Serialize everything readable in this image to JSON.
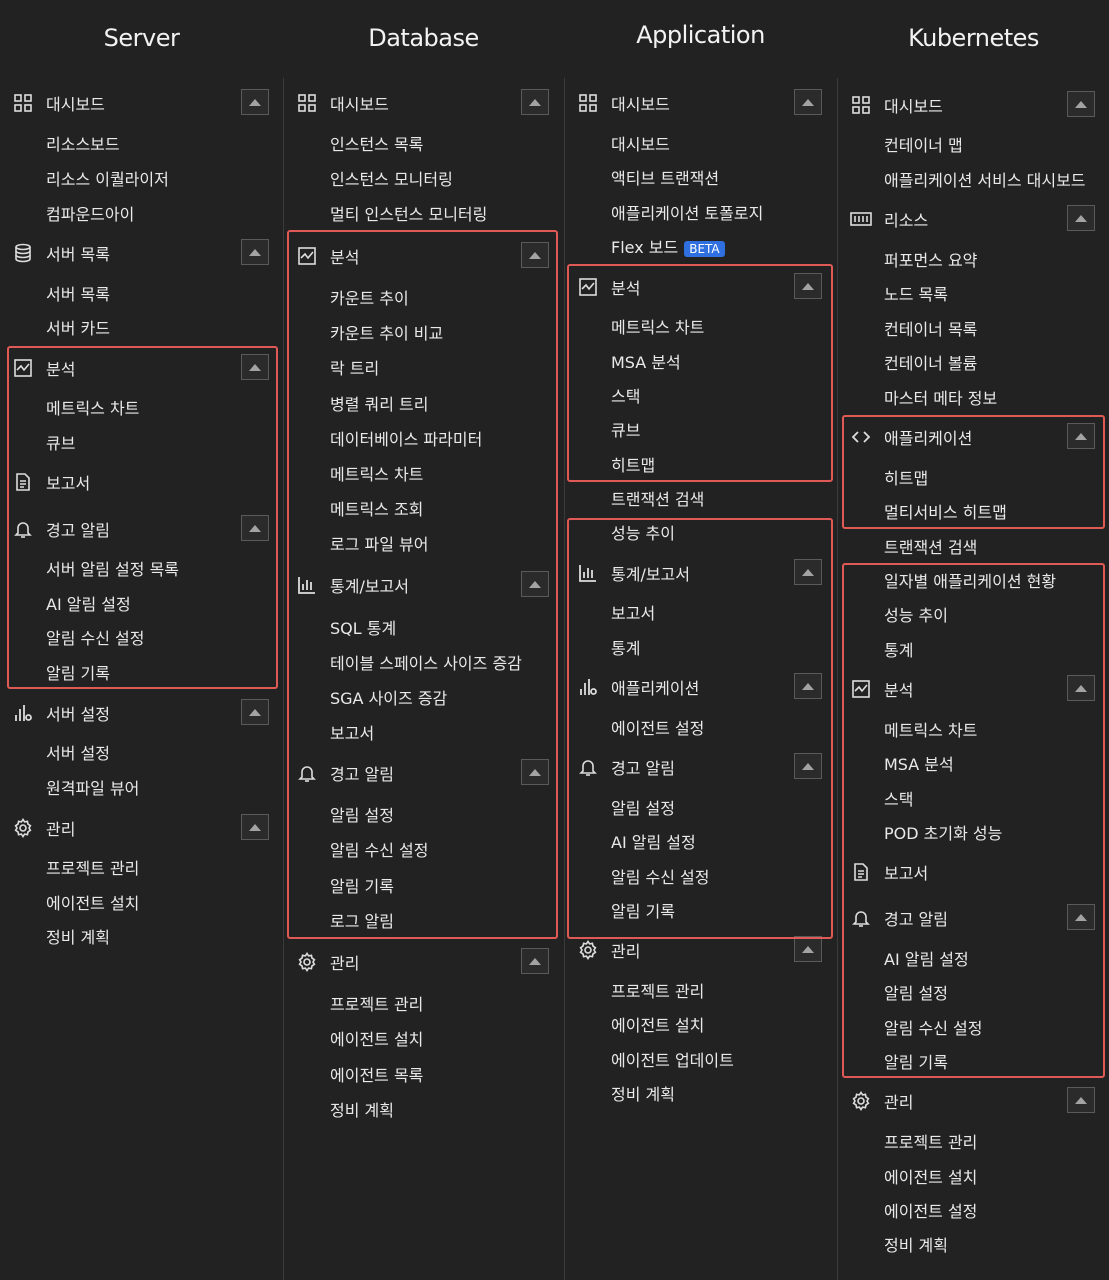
{
  "columns": {
    "server": {
      "title": "Server",
      "dashboard": "대시보드",
      "resource_board": "리소스보드",
      "resource_equalizer": "리소스 이퀄라이저",
      "compound_eye": "컴파운드아이",
      "server_list_section": "서버 목록",
      "server_list": "서버 목록",
      "server_card": "서버 카드",
      "analysis": "분석",
      "metrics_chart": "메트릭스 차트",
      "cube": "큐브",
      "report": "보고서",
      "alert": "경고 알림",
      "alert_setting_list": "서버 알림 설정 목록",
      "ai_alert": "AI 알림 설정",
      "alert_receive": "알림 수신 설정",
      "alert_history": "알림 기록",
      "server_setting_section": "서버 설정",
      "server_setting": "서버 설정",
      "remote_file_viewer": "원격파일 뷰어",
      "manage": "관리",
      "project_manage": "프로젝트 관리",
      "agent_install": "에이전트 설치",
      "maintenance": "정비 계획"
    },
    "database": {
      "title": "Database",
      "dashboard": "대시보드",
      "instance_list": "인스턴스 목록",
      "instance_monitoring": "인스턴스 모니터링",
      "multi_instance": "멀티 인스턴스 모니터링",
      "analysis": "분석",
      "count_trend": "카운트 추이",
      "count_compare": "카운트 추이 비교",
      "lock_tree": "락 트리",
      "parallel_query": "병렬 쿼리 트리",
      "db_param": "데이터베이스 파라미터",
      "metrics_chart": "메트릭스 차트",
      "metrics_query": "메트릭스 조회",
      "log_viewer": "로그 파일 뷰어",
      "stats_section": "통계/보고서",
      "sql_stats": "SQL 통계",
      "tablespace": "테이블 스페이스 사이즈 증감",
      "sga": "SGA 사이즈 증감",
      "report": "보고서",
      "alert": "경고 알림",
      "alert_setting": "알림 설정",
      "alert_receive": "알림 수신 설정",
      "alert_history": "알림 기록",
      "log_alert": "로그 알림",
      "manage": "관리",
      "project_manage": "프로젝트 관리",
      "agent_install": "에이전트 설치",
      "agent_list": "에이전트 목록",
      "maintenance": "정비 계획"
    },
    "application": {
      "title": "Application",
      "dashboard": "대시보드",
      "dashboard_item": "대시보드",
      "active_tx": "액티브 트랜잭션",
      "app_topology": "애플리케이션 토폴로지",
      "flex_board": "Flex 보드",
      "beta": "BETA",
      "analysis": "분석",
      "metrics_chart": "메트릭스 차트",
      "msa": "MSA 분석",
      "stack": "스택",
      "cube": "큐브",
      "heatmap": "히트맵",
      "tx_search": "트랜잭션 검색",
      "perf_trend": "성능 추이",
      "stats_section": "통계/보고서",
      "report": "보고서",
      "stats": "통계",
      "app_section": "애플리케이션",
      "agent_setting": "에이전트 설정",
      "alert": "경고 알림",
      "alert_setting": "알림 설정",
      "ai_alert": "AI 알림 설정",
      "alert_receive": "알림 수신 설정",
      "alert_history": "알림 기록",
      "manage": "관리",
      "project_manage": "프로젝트 관리",
      "agent_install": "에이전트 설치",
      "agent_update": "에이전트 업데이트",
      "maintenance": "정비 계획"
    },
    "kubernetes": {
      "title": "Kubernetes",
      "dashboard": "대시보드",
      "container_map": "컨테이너 맵",
      "app_service_dashboard": "애플리케이션 서비스 대시보드",
      "resource": "리소스",
      "perf_summary": "퍼포먼스 요약",
      "node_list": "노드 목록",
      "container_list": "컨테이너 목록",
      "container_volume": "컨테이너 볼륨",
      "master_meta": "마스터 메타 정보",
      "app_section": "애플리케이션",
      "heatmap": "히트맵",
      "multi_heatmap": "멀티서비스 히트맵",
      "tx_search": "트랜잭션 검색",
      "daily_app": "일자별 애플리케이션 현황",
      "perf_trend": "성능 추이",
      "stats": "통계",
      "analysis": "분석",
      "metrics_chart": "메트릭스 차트",
      "msa": "MSA 분석",
      "stack": "스택",
      "pod_init": "POD 초기화 성능",
      "report": "보고서",
      "alert": "경고 알림",
      "ai_alert": "AI 알림 설정",
      "alert_setting": "알림 설정",
      "alert_receive": "알림 수신 설정",
      "alert_history": "알림 기록",
      "manage": "관리",
      "project_manage": "프로젝트 관리",
      "agent_install": "에이전트 설치",
      "agent_setting": "에이전트 설정",
      "maintenance": "정비 계획"
    }
  },
  "colors": {
    "background": "#222222",
    "text": "#e9e9e9",
    "highlight": "#e05a55",
    "badge": "#2f6fe0"
  },
  "icons": [
    "dashboard-grid-icon",
    "database-icon",
    "analysis-chart-icon",
    "report-document-icon",
    "bell-icon",
    "bar-settings-icon",
    "gear-icon",
    "bar-chart-icon",
    "code-brackets-icon",
    "resource-icon",
    "collapse-arrow-icon"
  ]
}
